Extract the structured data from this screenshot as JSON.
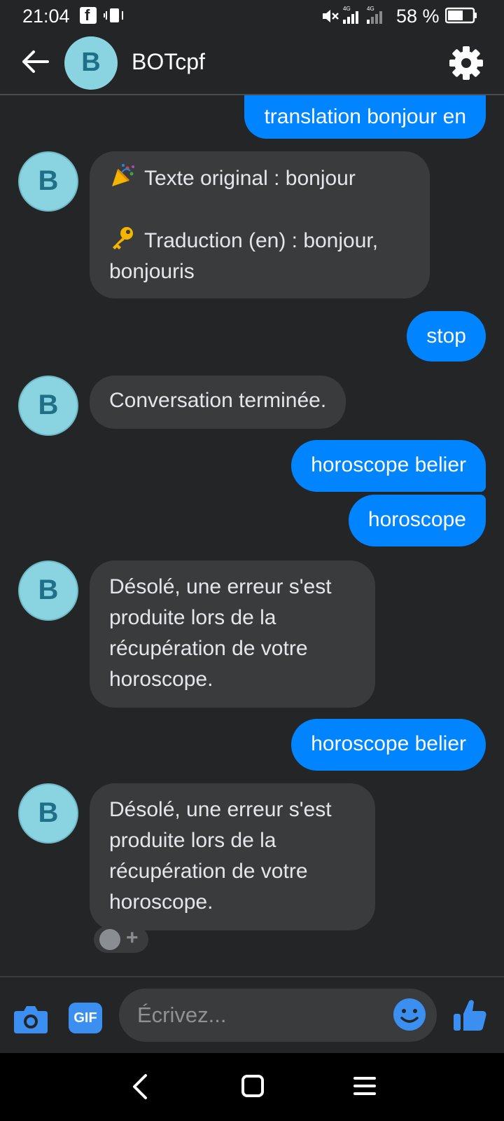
{
  "status_bar": {
    "time": "21:04",
    "network_1": "4G",
    "network_2": "4G",
    "battery": "58 %"
  },
  "header": {
    "avatar_letter": "B",
    "title": "BOTcpf"
  },
  "messages": [
    {
      "side": "out",
      "text": "translation bonjour en"
    },
    {
      "side": "in",
      "lines": [
        "Texte original : bonjour",
        "Traduction (en) : bonjour, bonjouris"
      ],
      "icons": [
        "party-popper-icon",
        "key-icon"
      ]
    },
    {
      "side": "out",
      "text": "stop"
    },
    {
      "side": "in",
      "text": "Conversation terminée."
    },
    {
      "side": "out",
      "text": "horoscope belier"
    },
    {
      "side": "out",
      "text": "horoscope"
    },
    {
      "side": "in",
      "text": "Désolé, une erreur s'est produite lors de la récupération de votre horoscope."
    },
    {
      "side": "out",
      "text": "horoscope belier"
    },
    {
      "side": "in",
      "text": "Désolé, une erreur s'est produite lors de la récupération de votre horoscope."
    }
  ],
  "composer": {
    "gif_label": "GIF",
    "placeholder": "Écrivez..."
  },
  "colors": {
    "background": "#242526",
    "outgoing_bubble": "#0084ff",
    "incoming_bubble": "#3a3b3c",
    "avatar": "#8ad3e0",
    "accent": "#3a8ff0"
  }
}
